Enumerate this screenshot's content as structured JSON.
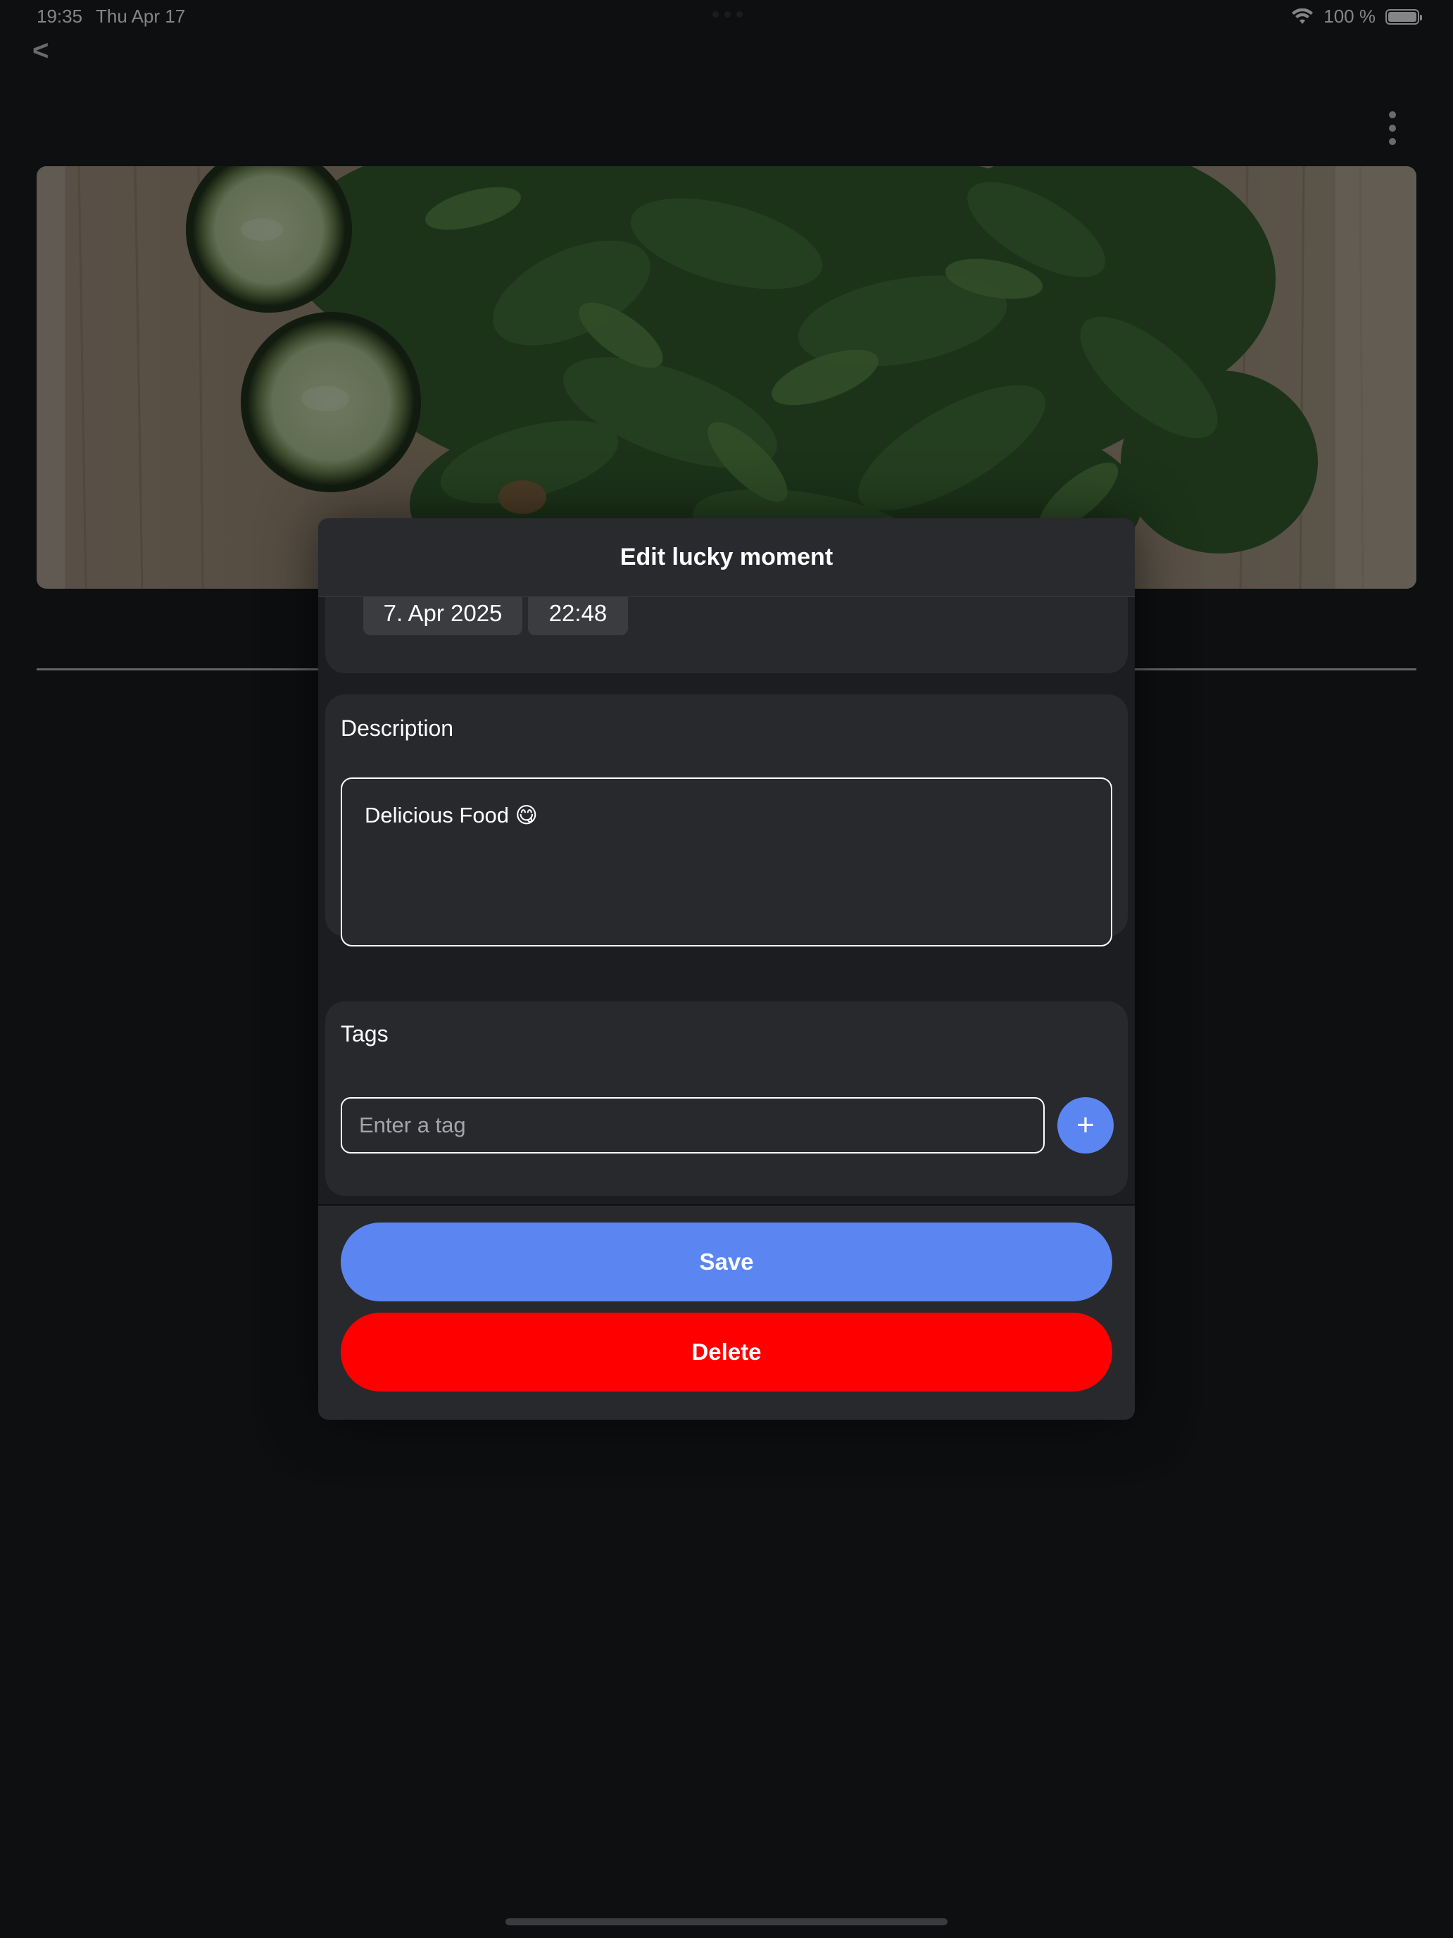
{
  "status_bar": {
    "time": "19:35",
    "date": "Thu Apr 17",
    "battery_percent": "100 %"
  },
  "nav": {
    "back_label": "<"
  },
  "modal": {
    "title": "Edit lucky moment",
    "date_value": "7. Apr 2025",
    "time_value": "22:48",
    "description": {
      "label": "Description",
      "value": "Delicious Food 😋"
    },
    "tags": {
      "label": "Tags",
      "placeholder": "Enter a tag",
      "add_label": "+"
    },
    "save_label": "Save",
    "delete_label": "Delete"
  },
  "colors": {
    "background": "#111214",
    "card": "#27292d",
    "header": "#282a2e",
    "accent_blue": "#5b86f2",
    "danger_red": "#ff0000"
  }
}
